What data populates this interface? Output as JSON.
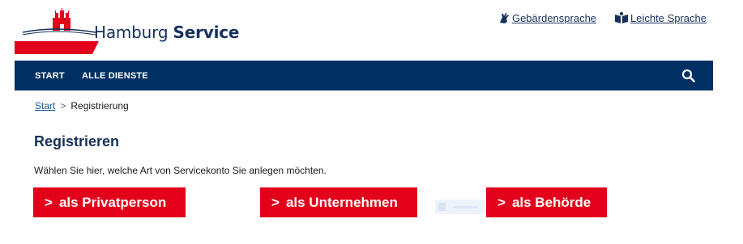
{
  "header": {
    "brand_prefix": "Hamburg",
    "brand_suffix": "Service",
    "brand_colors": {
      "navy": "#17315c",
      "red": "#e2001a"
    },
    "links": [
      {
        "label": "Gebärdensprache",
        "icon": "sign-language-icon"
      },
      {
        "label": "Leichte Sprache",
        "icon": "easy-language-book-icon"
      }
    ]
  },
  "nav": {
    "items": [
      "START",
      "ALLE DIENSTE"
    ],
    "search_icon": "search-icon",
    "background": "#003063"
  },
  "breadcrumb": {
    "home": "Start",
    "separator": ">",
    "current": "Registrierung"
  },
  "main": {
    "title": "Registrieren",
    "intro": "Wählen Sie hier, welche Art von Servicekonto Sie anlegen möchten.",
    "buttons": [
      {
        "arrow": ">",
        "label": "als Privatperson"
      },
      {
        "arrow": ">",
        "label": "als Unternehmen"
      },
      {
        "arrow": ">",
        "label": "als Behörde"
      }
    ]
  }
}
